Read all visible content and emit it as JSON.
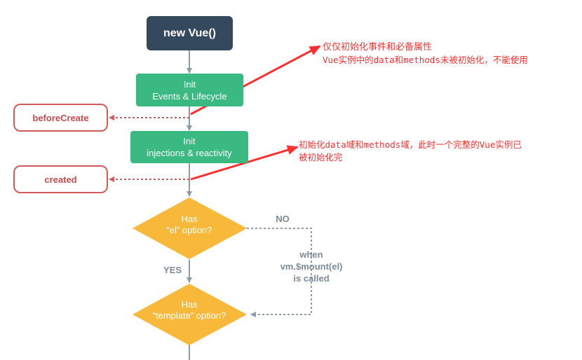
{
  "nodes": {
    "new_vue": "new Vue()",
    "init_events": {
      "line1": "Init",
      "line2": "Events & Lifecycle"
    },
    "init_injections": {
      "line1": "Init",
      "line2": "injections & reactivity"
    },
    "decision_el": {
      "line1": "Has",
      "line2": "“el” option?"
    },
    "decision_template": {
      "line1": "Has",
      "line2": "“template” option?"
    }
  },
  "hooks": {
    "before_create": "beforeCreate",
    "created": "created"
  },
  "labels": {
    "no": "NO",
    "yes": "YES",
    "when": {
      "line1": "when",
      "line2": "vm.$mount(el)",
      "line3": "is called"
    }
  },
  "annotations": {
    "before_create": {
      "line1": "仅仅初始化事件和必备属性",
      "line2": "Vue实例中的data和methods未被初始化，不能使用"
    },
    "created": {
      "line1": "初始化data域和methods域，此时一个完整的Vue实例已",
      "line2": "被初始化完"
    }
  },
  "colors": {
    "dark_node": "#35495e",
    "green_node": "#3ab982",
    "decision": "#f8b93b",
    "hook_border": "#d45a5a",
    "connector": "#8e9aa4",
    "annotation": "#ff2f2f"
  }
}
